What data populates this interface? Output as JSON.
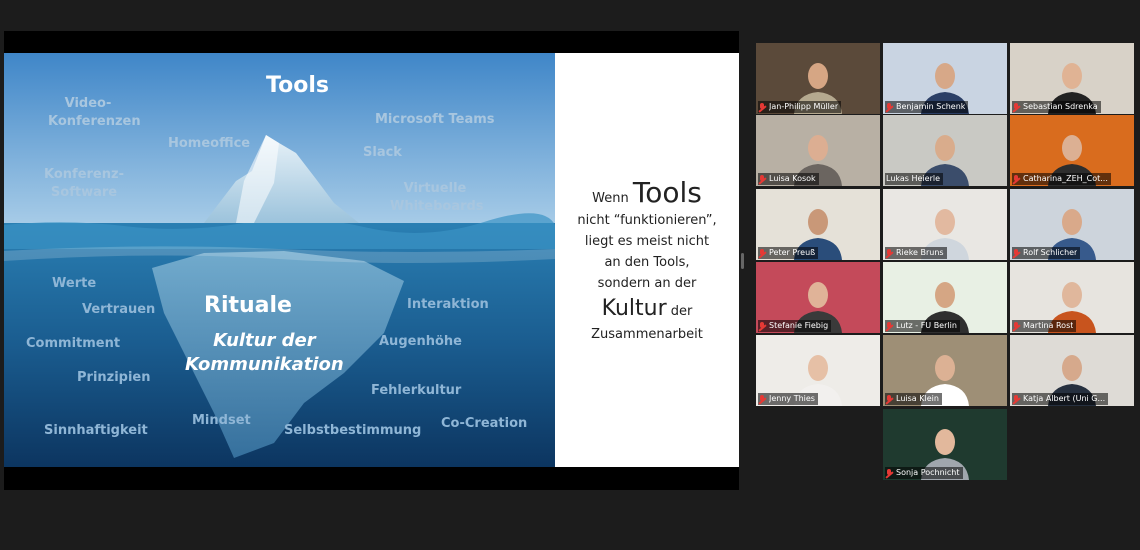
{
  "slide": {
    "tools_heading": "Tools",
    "rituale_heading": "Rituale",
    "kultur_heading": "Kultur der\nKommunikation",
    "above_keywords": [
      {
        "id": "videokonferenzen",
        "text": "Video-\nKonferenzen"
      },
      {
        "id": "homeoffice",
        "text": "Homeoffice"
      },
      {
        "id": "konferenz-software",
        "text": "Konferenz-\nSoftware"
      },
      {
        "id": "microsoft-teams",
        "text": "Microsoft Teams"
      },
      {
        "id": "slack",
        "text": "Slack"
      },
      {
        "id": "virtuelle-whiteboards",
        "text": "Virtuelle\nWhiteboards"
      }
    ],
    "below_keywords": [
      {
        "id": "werte",
        "text": "Werte"
      },
      {
        "id": "vertrauen",
        "text": "Vertrauen"
      },
      {
        "id": "commitment",
        "text": "Commitment"
      },
      {
        "id": "prinzipien",
        "text": "Prinzipien"
      },
      {
        "id": "sinnhaftigkeit",
        "text": "Sinnhaftigkeit"
      },
      {
        "id": "mindset",
        "text": "Mindset"
      },
      {
        "id": "selbstbestimmung",
        "text": "Selbstbestimmung"
      },
      {
        "id": "interaktion",
        "text": "Interaktion"
      },
      {
        "id": "augenhoehe",
        "text": "Augenhöhe"
      },
      {
        "id": "fehlerkultur",
        "text": "Fehlerkultur"
      },
      {
        "id": "co-creation",
        "text": "Co-Creation"
      }
    ],
    "text_panel": {
      "wenn": "Wenn",
      "tools": "Tools",
      "line1": "nicht “funktionieren”,",
      "line2": "liegt es meist nicht",
      "line3": "an den Tools,",
      "line4": "sondern an der",
      "kultur": "Kultur",
      "der": "der",
      "line5": "Zusammenarbeit"
    },
    "colors": {
      "sky": "#4f8fcb",
      "sea": "#1c5f92",
      "panel": "#ffffff",
      "keyword": "#a8c6df"
    }
  },
  "participants": [
    {
      "name": "Jan-Philipp Müller",
      "muted": true,
      "active": false,
      "bg": "#5b4a3a",
      "shirt": "#b5a98f",
      "skin": "#d6a684"
    },
    {
      "name": "Benjamin Schenk",
      "muted": true,
      "active": false,
      "bg": "#c9d4e2",
      "shirt": "#2b3f66",
      "skin": "#d7a888"
    },
    {
      "name": "Sebastian Sdrenka",
      "muted": true,
      "active": false,
      "bg": "#d8d2c8",
      "shirt": "#222222",
      "skin": "#e0b394"
    },
    {
      "name": "Luisa Kosok",
      "muted": true,
      "active": false,
      "bg": "#b8b0a4",
      "shirt": "#6b6560",
      "skin": "#dcae92"
    },
    {
      "name": "Lukas Heierle",
      "muted": false,
      "active": true,
      "bg": "#c9c9c4",
      "shirt": "#3b4d6b",
      "skin": "#d9ac8c"
    },
    {
      "name": "Catharina_ZEH_Cot...",
      "muted": true,
      "active": false,
      "bg": "#d96c1e",
      "shirt": "#2d2d2d",
      "skin": "#dcb093"
    },
    {
      "name": "Peter Preuß",
      "muted": true,
      "active": false,
      "bg": "#e5e1d8",
      "shirt": "#2a4d7a",
      "skin": "#c99878"
    },
    {
      "name": "Rieke Bruns",
      "muted": true,
      "active": false,
      "bg": "#e9e7e3",
      "shirt": "#cfd6dd",
      "skin": "#e2b9a0"
    },
    {
      "name": "Rolf Schlicher",
      "muted": true,
      "active": false,
      "bg": "#cdd4dc",
      "shirt": "#375a8c",
      "skin": "#d9a98a"
    },
    {
      "name": "Stefanie Fiebig",
      "muted": true,
      "active": false,
      "bg": "#c44a5a",
      "shirt": "#3a3a3a",
      "skin": "#e0b398"
    },
    {
      "name": "Lutz - FU Berlin",
      "muted": true,
      "active": false,
      "bg": "#e8f0e4",
      "shirt": "#2f2f2f",
      "skin": "#d5a684"
    },
    {
      "name": "Martina Rost",
      "muted": true,
      "active": false,
      "bg": "#e7e4df",
      "shirt": "#c8541e",
      "skin": "#e0b79c"
    },
    {
      "name": "Jenny Thies",
      "muted": true,
      "active": false,
      "bg": "#eeece8",
      "shirt": "#f2f0ee",
      "skin": "#e6c0a6"
    },
    {
      "name": "Luisa Klein",
      "muted": true,
      "active": false,
      "bg": "#9e8f76",
      "shirt": "#ffffff",
      "skin": "#dcb194"
    },
    {
      "name": "Katja Albert (Uni G...",
      "muted": true,
      "active": false,
      "bg": "#dedbd6",
      "shirt": "#26303f",
      "skin": "#d6a98c"
    },
    {
      "name": "Sonja Pochnicht",
      "muted": true,
      "active": false,
      "bg": "#1f3a2f",
      "shirt": "#a0a6ad",
      "skin": "#e2b89c"
    }
  ]
}
